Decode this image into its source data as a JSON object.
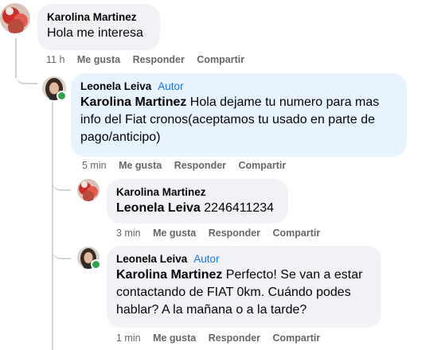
{
  "comments": [
    {
      "author": "Karolina Martinez",
      "text": "Hola me interesa",
      "time": "11 h",
      "actions": [
        "Me gusta",
        "Responder",
        "Compartir"
      ]
    },
    {
      "author": "Leonela Leiva",
      "badge": "Autor",
      "mention": "Karolina Martinez",
      "text": " Hola dejame tu numero para mas info del Fiat cronos(aceptamos tu usado en parte de pago/anticipo)",
      "time": "5 min",
      "actions": [
        "Me gusta",
        "Responder",
        "Compartir"
      ]
    },
    {
      "author": "Karolina Martinez",
      "mention": "Leonela Leiva",
      "text": " 2246411234",
      "time": "3 min",
      "actions": [
        "Me gusta",
        "Responder",
        "Compartir"
      ]
    },
    {
      "author": "Leonela Leiva",
      "badge": "Autor",
      "mention": "Karolina Martinez",
      "text": " Perfecto! Se van a estar contactando de FIAT 0km. Cuándo podes hablar? A la mañana o a la tarde?",
      "time": "1 min",
      "actions": [
        "Me gusta",
        "Responder",
        "Compartir"
      ]
    }
  ],
  "colors": {
    "bubble_grey": "#f0f2f5",
    "bubble_blue": "#e7f3ff",
    "author_badge": "#1877f2",
    "meta_text": "#65676b",
    "online": "#31a24c"
  }
}
